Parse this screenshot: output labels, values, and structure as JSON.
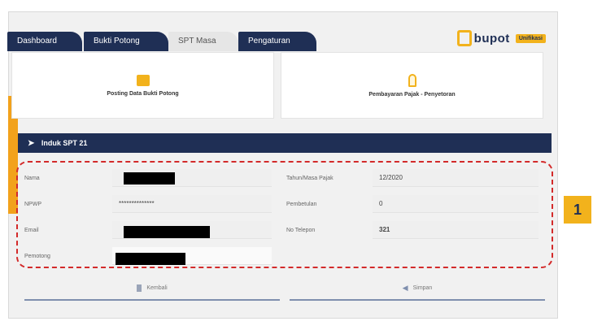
{
  "tabs": [
    "Dashboard",
    "Bukti Potong",
    "SPT Masa",
    "Pengaturan"
  ],
  "logo": {
    "text": "bupot",
    "badge": "Unifikasi"
  },
  "cards": [
    "Posting Data Bukti Potong",
    "Pembayaran Pajak - Penyetoran"
  ],
  "section": {
    "title": "Induk SPT 21"
  },
  "form": {
    "left": [
      {
        "label": "Nama",
        "value": ""
      },
      {
        "label": "NPWP",
        "value": "**************"
      },
      {
        "label": "Email",
        "value": ""
      },
      {
        "label": "Pemotong",
        "value": ""
      }
    ],
    "right": [
      {
        "label": "Tahun/Masa Pajak",
        "value": "12/2020"
      },
      {
        "label": "Pembetulan",
        "value": "0"
      },
      {
        "label": "No Telepon",
        "value": "321"
      }
    ]
  },
  "marker": "1",
  "bottom_buttons": [
    "Kembali",
    "Simpan"
  ]
}
